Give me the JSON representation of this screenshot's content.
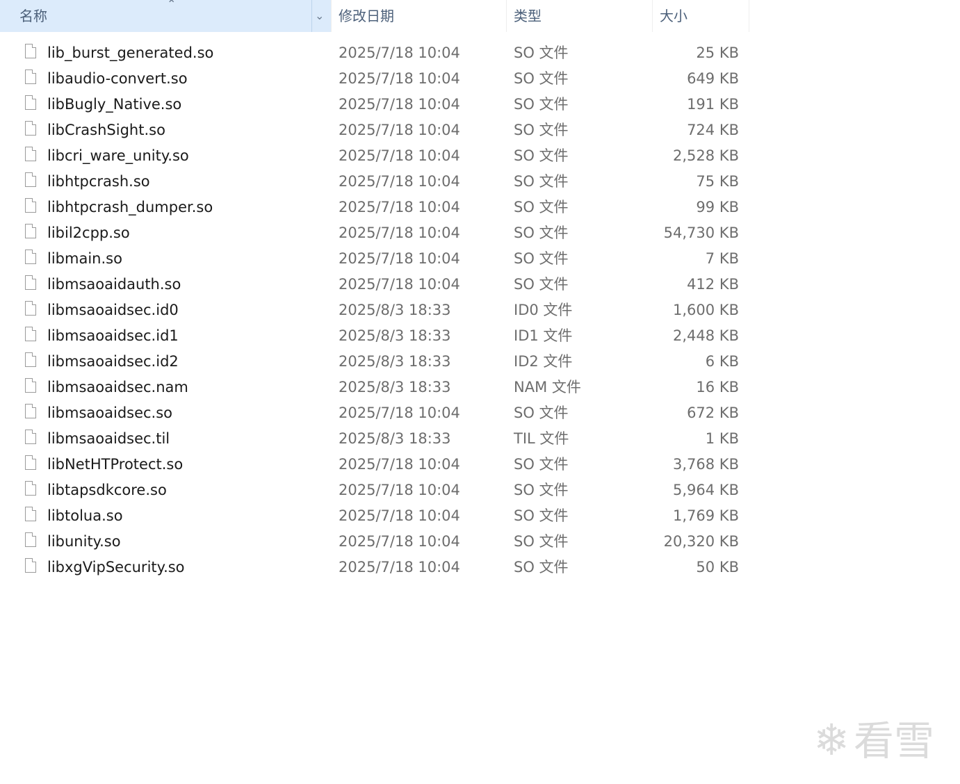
{
  "header": {
    "name_label": "名称",
    "date_label": "修改日期",
    "type_label": "类型",
    "size_label": "大小",
    "sort_arrow": "⌃",
    "dropdown_chevron": "⌄"
  },
  "files": [
    {
      "name": "lib_burst_generated.so",
      "date": "2025/7/18 10:04",
      "type": "SO 文件",
      "size": "25 KB"
    },
    {
      "name": "libaudio-convert.so",
      "date": "2025/7/18 10:04",
      "type": "SO 文件",
      "size": "649 KB"
    },
    {
      "name": "libBugly_Native.so",
      "date": "2025/7/18 10:04",
      "type": "SO 文件",
      "size": "191 KB"
    },
    {
      "name": "libCrashSight.so",
      "date": "2025/7/18 10:04",
      "type": "SO 文件",
      "size": "724 KB"
    },
    {
      "name": "libcri_ware_unity.so",
      "date": "2025/7/18 10:04",
      "type": "SO 文件",
      "size": "2,528 KB"
    },
    {
      "name": "libhtpcrash.so",
      "date": "2025/7/18 10:04",
      "type": "SO 文件",
      "size": "75 KB"
    },
    {
      "name": "libhtpcrash_dumper.so",
      "date": "2025/7/18 10:04",
      "type": "SO 文件",
      "size": "99 KB"
    },
    {
      "name": "libil2cpp.so",
      "date": "2025/7/18 10:04",
      "type": "SO 文件",
      "size": "54,730 KB"
    },
    {
      "name": "libmain.so",
      "date": "2025/7/18 10:04",
      "type": "SO 文件",
      "size": "7 KB"
    },
    {
      "name": "libmsaoaidauth.so",
      "date": "2025/7/18 10:04",
      "type": "SO 文件",
      "size": "412 KB"
    },
    {
      "name": "libmsaoaidsec.id0",
      "date": "2025/8/3 18:33",
      "type": "ID0 文件",
      "size": "1,600 KB"
    },
    {
      "name": "libmsaoaidsec.id1",
      "date": "2025/8/3 18:33",
      "type": "ID1 文件",
      "size": "2,448 KB"
    },
    {
      "name": "libmsaoaidsec.id2",
      "date": "2025/8/3 18:33",
      "type": "ID2 文件",
      "size": "6 KB"
    },
    {
      "name": "libmsaoaidsec.nam",
      "date": "2025/8/3 18:33",
      "type": "NAM 文件",
      "size": "16 KB"
    },
    {
      "name": "libmsaoaidsec.so",
      "date": "2025/7/18 10:04",
      "type": "SO 文件",
      "size": "672 KB"
    },
    {
      "name": "libmsaoaidsec.til",
      "date": "2025/8/3 18:33",
      "type": "TIL 文件",
      "size": "1 KB"
    },
    {
      "name": "libNetHTProtect.so",
      "date": "2025/7/18 10:04",
      "type": "SO 文件",
      "size": "3,768 KB"
    },
    {
      "name": "libtapsdkcore.so",
      "date": "2025/7/18 10:04",
      "type": "SO 文件",
      "size": "5,964 KB"
    },
    {
      "name": "libtolua.so",
      "date": "2025/7/18 10:04",
      "type": "SO 文件",
      "size": "1,769 KB"
    },
    {
      "name": "libunity.so",
      "date": "2025/7/18 10:04",
      "type": "SO 文件",
      "size": "20,320 KB"
    },
    {
      "name": "libxgVipSecurity.so",
      "date": "2025/7/18 10:04",
      "type": "SO 文件",
      "size": "50 KB"
    }
  ],
  "watermark": {
    "text": "看雪",
    "icon": "snowflake-icon",
    "glyph": "❄"
  },
  "colors": {
    "header_selected_bg": "#dcebfb",
    "text_primary": "#1a1a1a",
    "text_secondary": "#6d6d6d"
  }
}
